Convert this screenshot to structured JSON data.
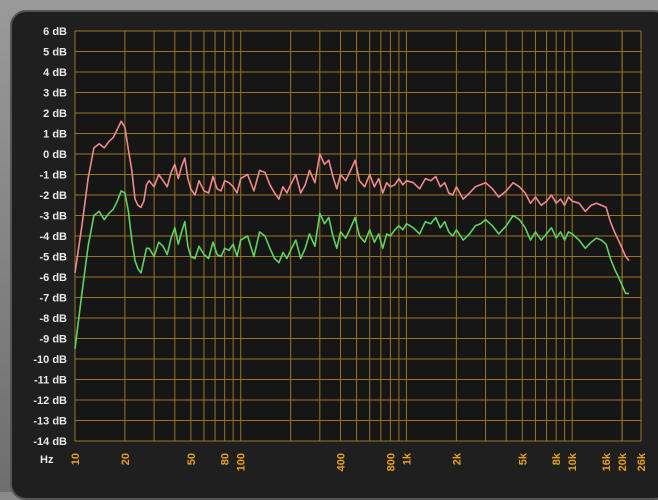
{
  "chart_data": {
    "type": "line",
    "x_scale": "log",
    "xlim": [
      10,
      26000
    ],
    "ylim": [
      -14,
      6
    ],
    "y_unit": "dB",
    "x_unit_label": "Hz",
    "grid": true,
    "y_ticks": [
      6,
      5,
      4,
      3,
      2,
      1,
      0,
      -1,
      -2,
      -3,
      -4,
      -5,
      -6,
      -7,
      -8,
      -9,
      -10,
      -11,
      -12,
      -13,
      -14
    ],
    "y_tick_labels": [
      "6 dB",
      "5 dB",
      "4 dB",
      "3 dB",
      "2 dB",
      "1 dB",
      "0 dB",
      "-1 dB",
      "-2 dB",
      "-3 dB",
      "-4 dB",
      "-5 dB",
      "-6 dB",
      "-7 dB",
      "-8 dB",
      "-9 dB",
      "-10 dB",
      "-11 dB",
      "-12 dB",
      "-13 dB",
      "-14 dB"
    ],
    "x_ticks": [
      {
        "value": 10,
        "label": "10"
      },
      {
        "value": 20,
        "label": "20"
      },
      {
        "value": 50,
        "label": "50"
      },
      {
        "value": 80,
        "label": "80"
      },
      {
        "value": 100,
        "label": "100"
      },
      {
        "value": 400,
        "label": "400"
      },
      {
        "value": 800,
        "label": "800"
      },
      {
        "value": 1000,
        "label": "1k"
      },
      {
        "value": 2000,
        "label": "2k"
      },
      {
        "value": 5000,
        "label": "5k"
      },
      {
        "value": 8000,
        "label": "8k"
      },
      {
        "value": 10000,
        "label": "10k"
      },
      {
        "value": 16000,
        "label": "16k"
      },
      {
        "value": 20000,
        "label": "20k"
      },
      {
        "value": 26000,
        "label": "26k"
      }
    ],
    "series": [
      {
        "color": "#f08a8a",
        "points": [
          [
            10,
            -5.8
          ],
          [
            11,
            -3.5
          ],
          [
            12,
            -1.2
          ],
          [
            13,
            0.3
          ],
          [
            14,
            0.5
          ],
          [
            15,
            0.3
          ],
          [
            16,
            0.6
          ],
          [
            17,
            0.8
          ],
          [
            18,
            1.2
          ],
          [
            19,
            1.6
          ],
          [
            20,
            1.3
          ],
          [
            21,
            0.2
          ],
          [
            22,
            -0.8
          ],
          [
            23,
            -2.2
          ],
          [
            24,
            -2.5
          ],
          [
            25,
            -2.6
          ],
          [
            26,
            -2.3
          ],
          [
            27,
            -1.5
          ],
          [
            28,
            -1.3
          ],
          [
            30,
            -1.6
          ],
          [
            32,
            -1.0
          ],
          [
            34,
            -1.3
          ],
          [
            36,
            -1.6
          ],
          [
            38,
            -0.9
          ],
          [
            40,
            -0.5
          ],
          [
            42,
            -1.2
          ],
          [
            44,
            -0.6
          ],
          [
            46,
            -0.2
          ],
          [
            48,
            -1.2
          ],
          [
            50,
            -1.7
          ],
          [
            53,
            -2.0
          ],
          [
            56,
            -1.3
          ],
          [
            60,
            -1.8
          ],
          [
            64,
            -1.9
          ],
          [
            68,
            -1.1
          ],
          [
            72,
            -1.7
          ],
          [
            76,
            -1.8
          ],
          [
            80,
            -1.3
          ],
          [
            85,
            -1.4
          ],
          [
            90,
            -1.6
          ],
          [
            95,
            -1.9
          ],
          [
            100,
            -1.2
          ],
          [
            110,
            -1.0
          ],
          [
            120,
            -1.8
          ],
          [
            130,
            -0.8
          ],
          [
            140,
            -0.9
          ],
          [
            150,
            -1.5
          ],
          [
            160,
            -1.9
          ],
          [
            170,
            -2.2
          ],
          [
            180,
            -1.6
          ],
          [
            190,
            -1.9
          ],
          [
            200,
            -1.5
          ],
          [
            215,
            -1.0
          ],
          [
            230,
            -1.9
          ],
          [
            245,
            -1.5
          ],
          [
            260,
            -0.8
          ],
          [
            280,
            -1.4
          ],
          [
            300,
            0.0
          ],
          [
            320,
            -0.5
          ],
          [
            340,
            -0.3
          ],
          [
            360,
            -1.1
          ],
          [
            380,
            -1.7
          ],
          [
            400,
            -1.0
          ],
          [
            430,
            -1.3
          ],
          [
            460,
            -0.8
          ],
          [
            490,
            -0.3
          ],
          [
            520,
            -1.3
          ],
          [
            560,
            -1.6
          ],
          [
            600,
            -1.0
          ],
          [
            640,
            -1.6
          ],
          [
            680,
            -1.2
          ],
          [
            720,
            -1.9
          ],
          [
            760,
            -1.4
          ],
          [
            800,
            -1.6
          ],
          [
            850,
            -1.5
          ],
          [
            900,
            -1.2
          ],
          [
            950,
            -1.5
          ],
          [
            1000,
            -1.3
          ],
          [
            1100,
            -1.4
          ],
          [
            1200,
            -1.7
          ],
          [
            1300,
            -1.2
          ],
          [
            1400,
            -1.3
          ],
          [
            1500,
            -1.1
          ],
          [
            1600,
            -1.6
          ],
          [
            1700,
            -1.4
          ],
          [
            1800,
            -1.9
          ],
          [
            1900,
            -2.0
          ],
          [
            2000,
            -1.6
          ],
          [
            2200,
            -2.2
          ],
          [
            2400,
            -1.9
          ],
          [
            2600,
            -1.6
          ],
          [
            2800,
            -1.5
          ],
          [
            3000,
            -1.4
          ],
          [
            3300,
            -1.7
          ],
          [
            3600,
            -2.1
          ],
          [
            4000,
            -1.8
          ],
          [
            4400,
            -1.4
          ],
          [
            4800,
            -1.6
          ],
          [
            5200,
            -1.9
          ],
          [
            5600,
            -2.4
          ],
          [
            6000,
            -2.1
          ],
          [
            6500,
            -2.5
          ],
          [
            7000,
            -2.3
          ],
          [
            7500,
            -2.0
          ],
          [
            8000,
            -2.4
          ],
          [
            8500,
            -2.2
          ],
          [
            9000,
            -2.5
          ],
          [
            9500,
            -2.1
          ],
          [
            10000,
            -2.3
          ],
          [
            11000,
            -2.4
          ],
          [
            12000,
            -2.8
          ],
          [
            13000,
            -2.5
          ],
          [
            14000,
            -2.4
          ],
          [
            15000,
            -2.5
          ],
          [
            16000,
            -2.6
          ],
          [
            17000,
            -3.3
          ],
          [
            18000,
            -3.8
          ],
          [
            19000,
            -4.2
          ],
          [
            20000,
            -4.6
          ],
          [
            21000,
            -5.0
          ],
          [
            22000,
            -5.2
          ]
        ]
      },
      {
        "color": "#5fd35f",
        "points": [
          [
            10,
            -9.5
          ],
          [
            11,
            -6.8
          ],
          [
            12,
            -4.5
          ],
          [
            13,
            -3.0
          ],
          [
            14,
            -2.8
          ],
          [
            15,
            -3.2
          ],
          [
            16,
            -2.9
          ],
          [
            17,
            -2.7
          ],
          [
            18,
            -2.3
          ],
          [
            19,
            -1.8
          ],
          [
            20,
            -1.9
          ],
          [
            21,
            -2.8
          ],
          [
            22,
            -4.2
          ],
          [
            23,
            -5.2
          ],
          [
            24,
            -5.6
          ],
          [
            25,
            -5.8
          ],
          [
            26,
            -5.2
          ],
          [
            27,
            -4.6
          ],
          [
            28,
            -4.6
          ],
          [
            30,
            -5.0
          ],
          [
            32,
            -4.3
          ],
          [
            34,
            -4.5
          ],
          [
            36,
            -4.9
          ],
          [
            38,
            -4.1
          ],
          [
            40,
            -3.6
          ],
          [
            42,
            -4.4
          ],
          [
            44,
            -3.8
          ],
          [
            46,
            -3.3
          ],
          [
            48,
            -4.5
          ],
          [
            50,
            -5.0
          ],
          [
            53,
            -5.1
          ],
          [
            56,
            -4.5
          ],
          [
            60,
            -4.9
          ],
          [
            64,
            -5.1
          ],
          [
            68,
            -4.3
          ],
          [
            72,
            -4.9
          ],
          [
            76,
            -5.0
          ],
          [
            80,
            -4.6
          ],
          [
            85,
            -4.7
          ],
          [
            90,
            -4.4
          ],
          [
            95,
            -5.0
          ],
          [
            100,
            -4.2
          ],
          [
            110,
            -4.0
          ],
          [
            120,
            -5.0
          ],
          [
            130,
            -3.8
          ],
          [
            140,
            -4.0
          ],
          [
            150,
            -4.6
          ],
          [
            160,
            -5.1
          ],
          [
            170,
            -5.3
          ],
          [
            180,
            -4.8
          ],
          [
            190,
            -5.1
          ],
          [
            200,
            -4.7
          ],
          [
            215,
            -4.2
          ],
          [
            230,
            -5.1
          ],
          [
            245,
            -4.6
          ],
          [
            260,
            -3.9
          ],
          [
            280,
            -4.5
          ],
          [
            300,
            -2.9
          ],
          [
            320,
            -3.4
          ],
          [
            340,
            -3.1
          ],
          [
            360,
            -4.0
          ],
          [
            380,
            -4.6
          ],
          [
            400,
            -3.8
          ],
          [
            430,
            -4.1
          ],
          [
            460,
            -3.6
          ],
          [
            490,
            -3.1
          ],
          [
            520,
            -4.0
          ],
          [
            560,
            -4.3
          ],
          [
            600,
            -3.7
          ],
          [
            640,
            -4.3
          ],
          [
            680,
            -3.9
          ],
          [
            720,
            -4.6
          ],
          [
            760,
            -3.9
          ],
          [
            800,
            -4.0
          ],
          [
            850,
            -3.7
          ],
          [
            900,
            -3.5
          ],
          [
            950,
            -3.7
          ],
          [
            1000,
            -3.4
          ],
          [
            1100,
            -3.6
          ],
          [
            1200,
            -3.9
          ],
          [
            1300,
            -3.3
          ],
          [
            1400,
            -3.4
          ],
          [
            1500,
            -3.1
          ],
          [
            1600,
            -3.6
          ],
          [
            1700,
            -3.3
          ],
          [
            1800,
            -3.8
          ],
          [
            1900,
            -4.0
          ],
          [
            2000,
            -3.7
          ],
          [
            2200,
            -4.2
          ],
          [
            2400,
            -3.9
          ],
          [
            2600,
            -3.5
          ],
          [
            2800,
            -3.4
          ],
          [
            3000,
            -3.2
          ],
          [
            3300,
            -3.5
          ],
          [
            3600,
            -3.9
          ],
          [
            4000,
            -3.5
          ],
          [
            4400,
            -3.0
          ],
          [
            4800,
            -3.2
          ],
          [
            5200,
            -3.6
          ],
          [
            5600,
            -4.2
          ],
          [
            6000,
            -3.8
          ],
          [
            6500,
            -4.2
          ],
          [
            7000,
            -3.9
          ],
          [
            7500,
            -3.6
          ],
          [
            8000,
            -4.1
          ],
          [
            8500,
            -3.8
          ],
          [
            9000,
            -4.2
          ],
          [
            9500,
            -3.8
          ],
          [
            10000,
            -3.9
          ],
          [
            11000,
            -4.2
          ],
          [
            12000,
            -4.6
          ],
          [
            13000,
            -4.3
          ],
          [
            14000,
            -4.1
          ],
          [
            15000,
            -4.2
          ],
          [
            16000,
            -4.4
          ],
          [
            17000,
            -5.1
          ],
          [
            18000,
            -5.6
          ],
          [
            19000,
            -6.0
          ],
          [
            20000,
            -6.4
          ],
          [
            21000,
            -6.8
          ],
          [
            22000,
            -6.8
          ]
        ]
      }
    ]
  }
}
